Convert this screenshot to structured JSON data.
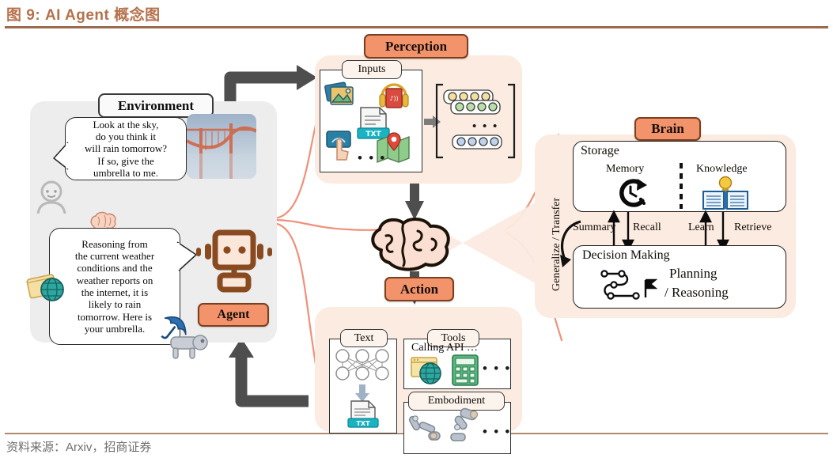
{
  "figure": {
    "title": "图 9: AI Agent 概念图",
    "source": "资料来源：Arxiv，招商证券",
    "accent_color": "#B5714B",
    "rule_color": "#9B6B4F"
  },
  "colors": {
    "badge_orange": "#F3936B",
    "badge_border": "#7B3F1D",
    "panel_peach": "#FCEBE0",
    "panel_gray": "#EDEDED",
    "arrow_gray": "#4E4E4E",
    "connector_salmon": "#F0907A",
    "robot_brown": "#8A4A20"
  },
  "environment": {
    "label": "Environment",
    "user_bubble": "Look at the sky,\ndo you think it\nwill rain tomorrow?\nIf so, give the\numbrella to me.",
    "agent_bubble": "Reasoning from\nthe current weather\nconditions and the\nweather reports on\nthe internet, it is\nlikely to rain\ntomorrow. Here is\nyour umbrella.",
    "icons": [
      "person-icon",
      "bridge-photo",
      "brain-icon",
      "globe-icon",
      "umbrella-icon",
      "robot-dog-icon"
    ]
  },
  "agent": {
    "label": "Agent",
    "icon": "robot-head-icon"
  },
  "perception": {
    "label": "Perception",
    "inputs_label": "Inputs",
    "input_icons": [
      "images-icon",
      "headphones-audio-icon",
      "text-document-icon",
      "touch-gesture-icon",
      "map-location-icon"
    ],
    "input_ellipsis": "• • •",
    "embedding_ellipsis": "• • •",
    "embedding_rows": [
      {
        "name": "row-yellow",
        "color": "#F5DFA0",
        "count": 4
      },
      {
        "name": "row-green",
        "color": "#B8DFA8",
        "count": 4
      },
      {
        "name": "row-blue",
        "color": "#BFD4EC",
        "count": 4
      }
    ]
  },
  "brain_center": {
    "icon": "brain-icon"
  },
  "brain": {
    "label": "Brain",
    "generalize_label": "Generalize / Transfer",
    "storage": {
      "label": "Storage",
      "memory_label": "Memory",
      "memory_icon": "clock-history-icon",
      "knowledge_label": "Knowledge",
      "knowledge_icon": "book-lightbulb-icon"
    },
    "arrows": [
      {
        "name": "summary-arrow",
        "label": "Summary"
      },
      {
        "name": "recall-arrow",
        "label": "Recall"
      },
      {
        "name": "learn-arrow",
        "label": "Learn"
      },
      {
        "name": "retrieve-arrow",
        "label": "Retrieve"
      }
    ],
    "decision": {
      "label": "Decision Making",
      "icon": "planning-path-flag-icon",
      "text_line1": "Planning",
      "text_line2": "/ Reasoning"
    }
  },
  "action": {
    "label": "Action",
    "text_box": {
      "label": "Text",
      "icons": [
        "neural-network-icon",
        "down-arrow-icon",
        "txt-document-icon"
      ]
    },
    "tools_box": {
      "label": "Tools",
      "caption": "Calling API …",
      "icons": [
        "browser-globe-icon",
        "calculator-icon"
      ],
      "ellipsis": "• • •"
    },
    "embodiment_box": {
      "label": "Embodiment",
      "icons": [
        "robot-arm-icon",
        "robot-leg-icon"
      ],
      "ellipsis": "• • •"
    }
  }
}
